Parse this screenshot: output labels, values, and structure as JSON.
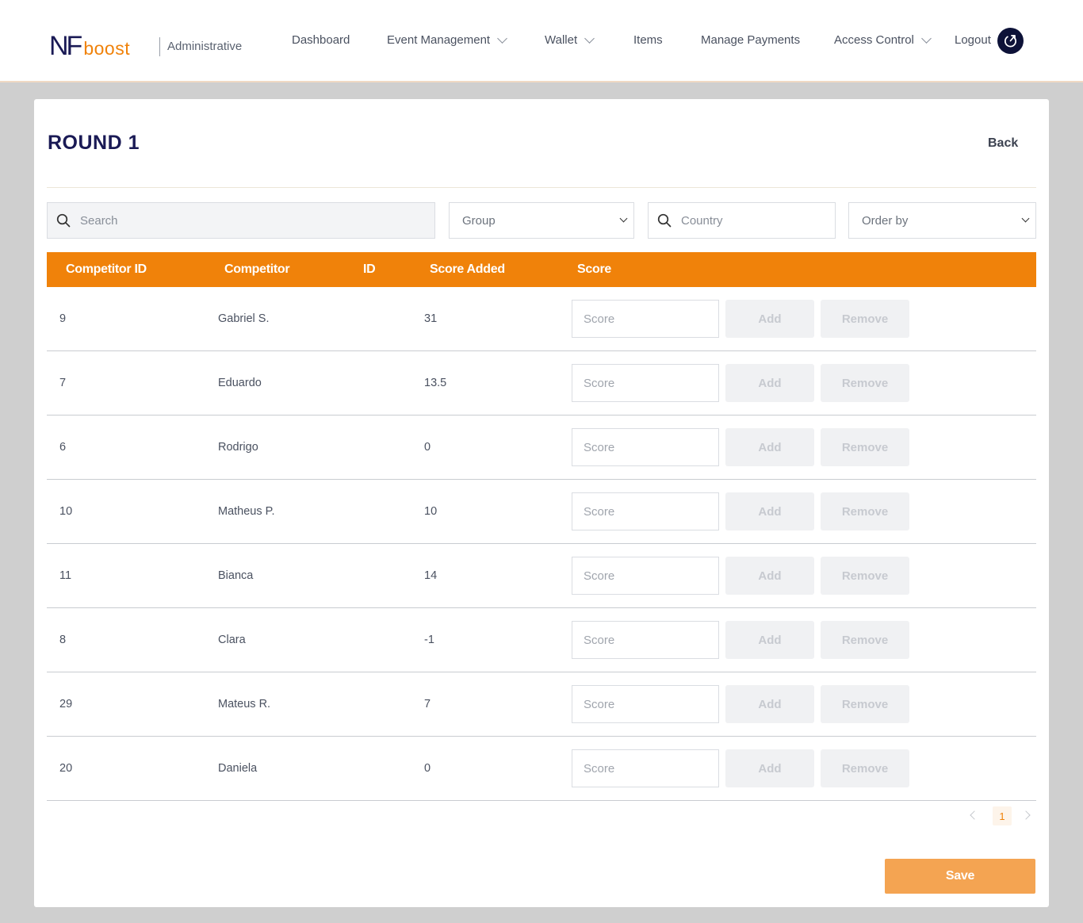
{
  "brand": {
    "logo_nf": "NF",
    "logo_boost": "boost",
    "subtitle": "Administrative",
    "colors": {
      "navy": "#1a1a55",
      "orange": "#f0820a",
      "save": "#f4a452"
    }
  },
  "nav": {
    "items": [
      {
        "label": "Dashboard",
        "dropdown": false
      },
      {
        "label": "Event Management",
        "dropdown": true
      },
      {
        "label": "Wallet",
        "dropdown": true
      },
      {
        "label": "Items",
        "dropdown": false
      },
      {
        "label": "Manage Payments",
        "dropdown": false
      },
      {
        "label": "Access Control",
        "dropdown": true
      },
      {
        "label": "Logout",
        "dropdown": false
      }
    ],
    "logout_icon": "power-icon"
  },
  "page": {
    "title": "ROUND 1",
    "back_label": "Back"
  },
  "filters": {
    "search_placeholder": "Search",
    "group_selected": "Group",
    "country_placeholder": "Country",
    "order_selected": "Order by"
  },
  "table": {
    "headers": [
      "Competitor ID",
      "Competitor",
      "ID",
      "Score Added",
      "Score"
    ],
    "score_placeholder": "Score",
    "add_label": "Add",
    "remove_label": "Remove",
    "rows": [
      {
        "competitor_id": "9",
        "competitor": "Gabriel S.",
        "id": "",
        "score_added": "31"
      },
      {
        "competitor_id": "7",
        "competitor": "Eduardo",
        "id": "",
        "score_added": "13.5"
      },
      {
        "competitor_id": "6",
        "competitor": "Rodrigo",
        "id": "",
        "score_added": "0"
      },
      {
        "competitor_id": "10",
        "competitor": "Matheus P.",
        "id": "",
        "score_added": "10"
      },
      {
        "competitor_id": "11",
        "competitor": "Bianca",
        "id": "",
        "score_added": "14"
      },
      {
        "competitor_id": "8",
        "competitor": "Clara",
        "id": "",
        "score_added": "-1"
      },
      {
        "competitor_id": "29",
        "competitor": "Mateus R.",
        "id": "",
        "score_added": "7"
      },
      {
        "competitor_id": "20",
        "competitor": "Daniela",
        "id": "",
        "score_added": "0"
      }
    ]
  },
  "pagination": {
    "current_page": "1"
  },
  "footer": {
    "save_label": "Save"
  }
}
